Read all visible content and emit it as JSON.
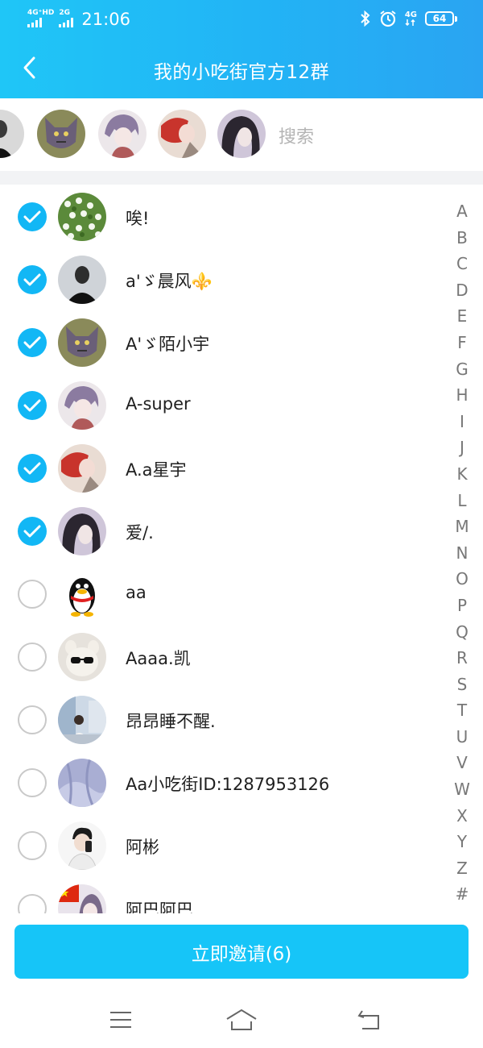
{
  "status_bar": {
    "network_left_1": "4G⁺HD",
    "network_left_2": "2G",
    "time": "21:06",
    "network_right": "4G",
    "battery": "64"
  },
  "header": {
    "title": "我的小吃街官方12群"
  },
  "search": {
    "placeholder": "搜索"
  },
  "members": [
    {
      "name": "唉!",
      "selected": true,
      "avatar": "flowers-avatar"
    },
    {
      "name": "a'ゞ晨风⚜️",
      "selected": true,
      "avatar": "dark-person-avatar"
    },
    {
      "name": "A'ゞ陌小宇",
      "selected": true,
      "avatar": "wolf-cartoon-avatar"
    },
    {
      "name": "A-super",
      "selected": true,
      "avatar": "anime-girl-avatar"
    },
    {
      "name": "A.a星宇",
      "selected": true,
      "avatar": "anime-red-avatar"
    },
    {
      "name": "爱/.",
      "selected": true,
      "avatar": "anime-dark-hair-avatar"
    },
    {
      "name": "aa",
      "selected": false,
      "avatar": "penguin-avatar"
    },
    {
      "name": "Aaaa.凯",
      "selected": false,
      "avatar": "sunglasses-bear-avatar"
    },
    {
      "name": "昂昂睡不醒.",
      "selected": false,
      "avatar": "photo-person-avatar"
    },
    {
      "name": "Aa小吃街ID:1287953126",
      "selected": false,
      "avatar": "purple-cloth-avatar"
    },
    {
      "name": "阿彬",
      "selected": false,
      "avatar": "selfie-avatar"
    },
    {
      "name": "阿巴阿巴",
      "selected": false,
      "avatar": "flag-girl-avatar"
    }
  ],
  "index_letters": [
    "A",
    "B",
    "C",
    "D",
    "E",
    "F",
    "G",
    "H",
    "I",
    "J",
    "K",
    "L",
    "M",
    "N",
    "O",
    "P",
    "Q",
    "R",
    "S",
    "T",
    "U",
    "V",
    "W",
    "X",
    "Y",
    "Z",
    "#"
  ],
  "invite": {
    "label": "立即邀请(6)"
  },
  "colors": {
    "header_gradient_start": "#1fc6f7",
    "header_gradient_end": "#2aa4f2",
    "accent": "#12b7f5",
    "invite_button": "#16c5f8"
  }
}
